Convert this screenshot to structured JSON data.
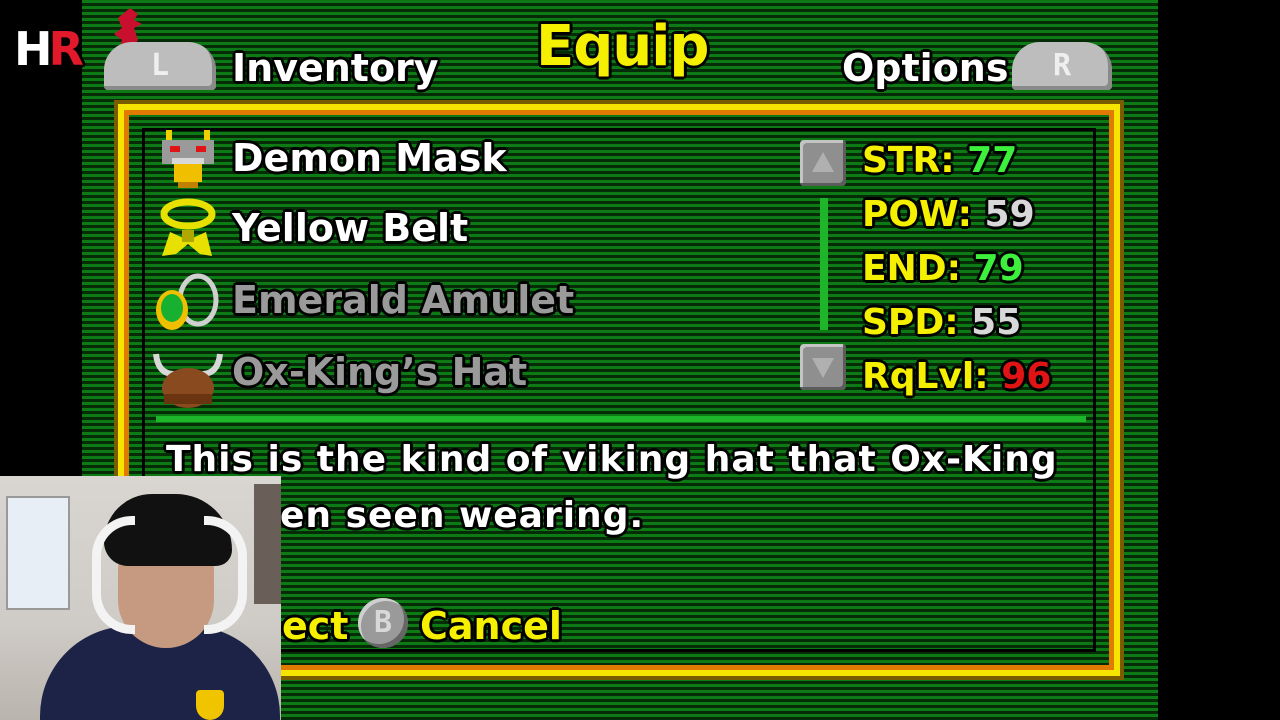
{
  "overlay": {
    "channel_logo": "HR"
  },
  "header": {
    "left_button": "L",
    "left_label": "Inventory",
    "title": "Equip",
    "right_label": "Options",
    "right_button": "R"
  },
  "items": [
    {
      "name": "Demon Mask",
      "icon": "demon-mask-icon",
      "color": "#ffffff"
    },
    {
      "name": "Yellow Belt",
      "icon": "yellow-belt-icon",
      "color": "#ffffff"
    },
    {
      "name": "Emerald Amulet",
      "icon": "emerald-amulet-icon",
      "color": "#9a9a9a"
    },
    {
      "name": "Ox-King’s Hat",
      "icon": "ox-king-hat-icon",
      "color": "#9a9a9a"
    }
  ],
  "stats": [
    {
      "label": "STR:",
      "value": "77",
      "color": "#3cf03c"
    },
    {
      "label": "POW:",
      "value": "59",
      "color": "#d8d8d8"
    },
    {
      "label": "END:",
      "value": "79",
      "color": "#3cf03c"
    },
    {
      "label": "SPD:",
      "value": "55",
      "color": "#d8d8d8"
    },
    {
      "label": "RqLvl:",
      "value": "96",
      "color": "#e01414"
    }
  ],
  "description": {
    "line1": "This is the kind of viking hat that Ox-King",
    "line2": "en seen wearing."
  },
  "footer": {
    "select_label": "ect",
    "cancel_button": "B",
    "cancel_label": "Cancel"
  },
  "colors": {
    "accent_yellow": "#f4f000",
    "background_green": "#0d7a16"
  }
}
